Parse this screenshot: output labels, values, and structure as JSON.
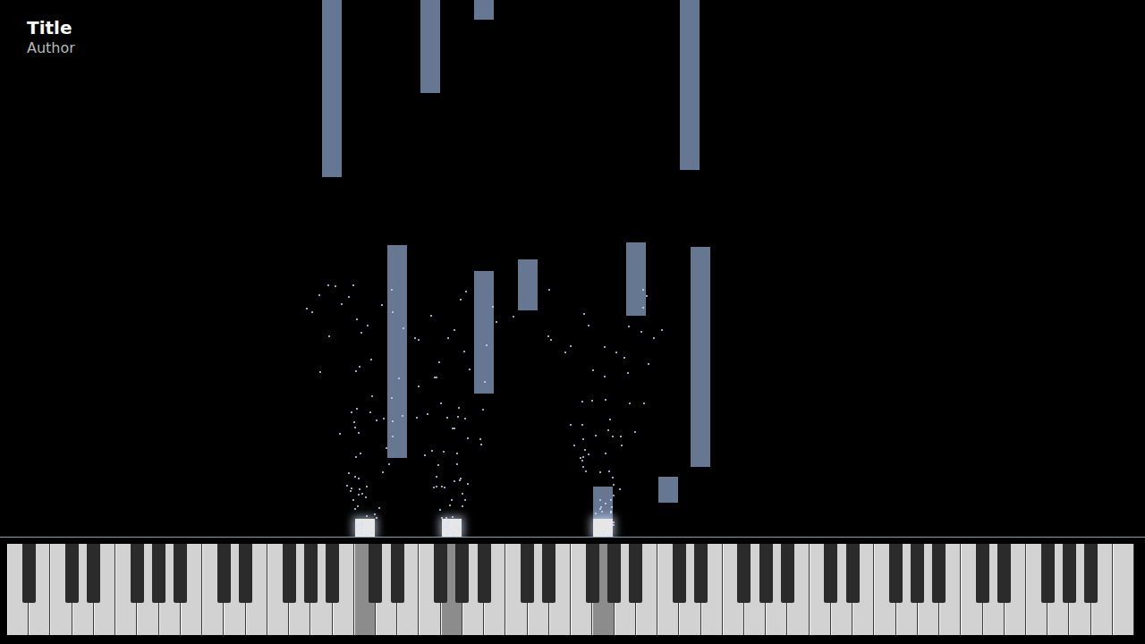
{
  "title": "Title",
  "author": "Author",
  "keyboard": {
    "key_count": 88,
    "pressed_keys": [
      27,
      34,
      46
    ]
  },
  "notes": [
    {
      "key": 25,
      "start": 4.02,
      "length": 2.3,
      "active": false
    },
    {
      "key": 32,
      "start": 4.96,
      "length": 1.2,
      "active": false
    },
    {
      "key": 37,
      "start": 5.78,
      "length": 0.4,
      "active": false
    },
    {
      "key": 53,
      "start": 4.1,
      "length": 2.1,
      "active": false
    },
    {
      "key": 30,
      "start": 0.88,
      "length": 2.38,
      "active": false
    },
    {
      "key": 37,
      "start": 1.6,
      "length": 1.37,
      "active": false
    },
    {
      "key": 40,
      "start": 2.53,
      "length": 0.57,
      "active": false
    },
    {
      "key": 49,
      "start": 2.47,
      "length": 0.82,
      "active": false
    },
    {
      "key": 54,
      "start": 0.78,
      "length": 2.46,
      "active": false
    },
    {
      "key": 51,
      "start": 0.38,
      "length": 0.29,
      "active": false
    },
    {
      "key": 46,
      "start": 0.2,
      "length": 0.36,
      "active": false
    },
    {
      "key": 46,
      "start": 0,
      "length": 0.2,
      "active": true
    },
    {
      "key": 27,
      "start": 0,
      "length": 0.2,
      "active": true
    },
    {
      "key": 34,
      "start": 0,
      "length": 0.2,
      "active": true
    }
  ]
}
